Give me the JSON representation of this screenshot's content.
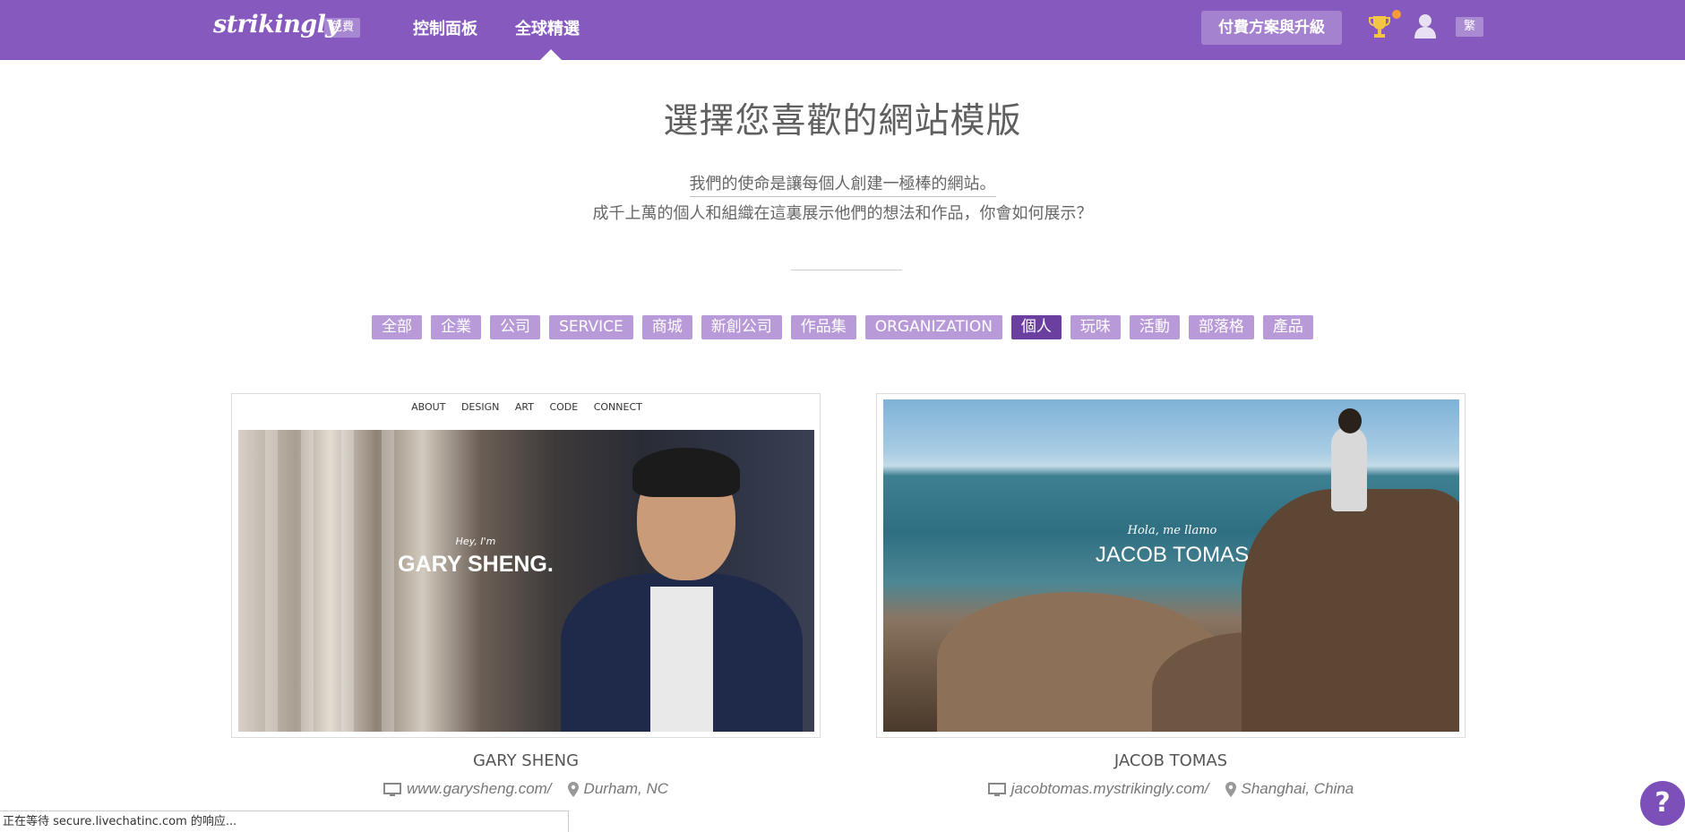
{
  "header": {
    "logo": "strikingly",
    "plan_badge": "免費",
    "nav": [
      "控制面板",
      "全球精選"
    ],
    "upgrade_button": "付費方案與升級",
    "language_button": "繁",
    "accent_color": "#8659bf"
  },
  "hero": {
    "title": "選擇您喜歡的網站模版",
    "mission": "我們的使命是讓每個人創建一極棒的網站。",
    "subtitle": "成千上萬的個人和組織在這裏展示他們的想法和作品，你會如何展示？"
  },
  "filters": {
    "tags": [
      "全部",
      "企業",
      "公司",
      "SERVICE",
      "商城",
      "新創公司",
      "作品集",
      "ORGANIZATION",
      "個人",
      "玩味",
      "活動",
      "部落格",
      "產品"
    ],
    "active": "個人"
  },
  "templates": [
    {
      "name": "GARY SHENG",
      "url": "www.garysheng.com/",
      "location": "Durham, NC",
      "preview_nav": [
        "ABOUT",
        "DESIGN",
        "ART",
        "CODE",
        "CONNECT"
      ],
      "preview_intro": "Hey, I'm",
      "preview_title": "GARY SHENG."
    },
    {
      "name": "JACOB TOMAS",
      "url": "jacobtomas.mystrikingly.com/",
      "location": "Shanghai, China",
      "preview_intro": "Hola, me llamo",
      "preview_title": "JACOB TOMAS"
    }
  ],
  "status_bar": "正在等待 secure.livechatinc.com 的响应...",
  "help_button": "?"
}
